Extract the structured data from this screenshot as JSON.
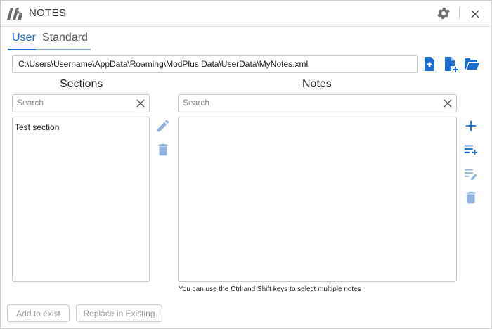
{
  "window": {
    "title": "NOTES"
  },
  "tabs": [
    {
      "label": "User",
      "active": true
    },
    {
      "label": "Standard",
      "active": false
    }
  ],
  "file_path": "C:\\Users\\Username\\AppData\\Roaming\\ModPlus Data\\UserData\\MyNotes.xml",
  "sections": {
    "heading": "Sections",
    "search_placeholder": "Search",
    "items": [
      "Test section"
    ]
  },
  "notes": {
    "heading": "Notes",
    "search_placeholder": "Search",
    "items": [],
    "hint": "You can use the Ctrl and Shift keys to select multiple notes"
  },
  "buttons": {
    "add_to_exist": "Add to exist",
    "replace_in_existing": "Replace in Existing"
  },
  "colors": {
    "accent": "#1c6fd1",
    "accent_light": "#8fb3de",
    "gear": "#6e6e6e",
    "button_text_disabled": "#9a9a9a"
  },
  "icons": {
    "app_logo": "modplus-logo-icon",
    "settings": "gear-icon",
    "close": "close-icon",
    "upload_file": "file-upload-icon",
    "new_file": "file-add-icon",
    "open_folder": "folder-open-icon",
    "edit_section": "pencil-icon",
    "delete_section": "trash-icon",
    "add_note": "plus-icon",
    "add_note_list": "playlist-add-icon",
    "edit_note": "playlist-edit-icon",
    "delete_note": "trash-icon"
  }
}
